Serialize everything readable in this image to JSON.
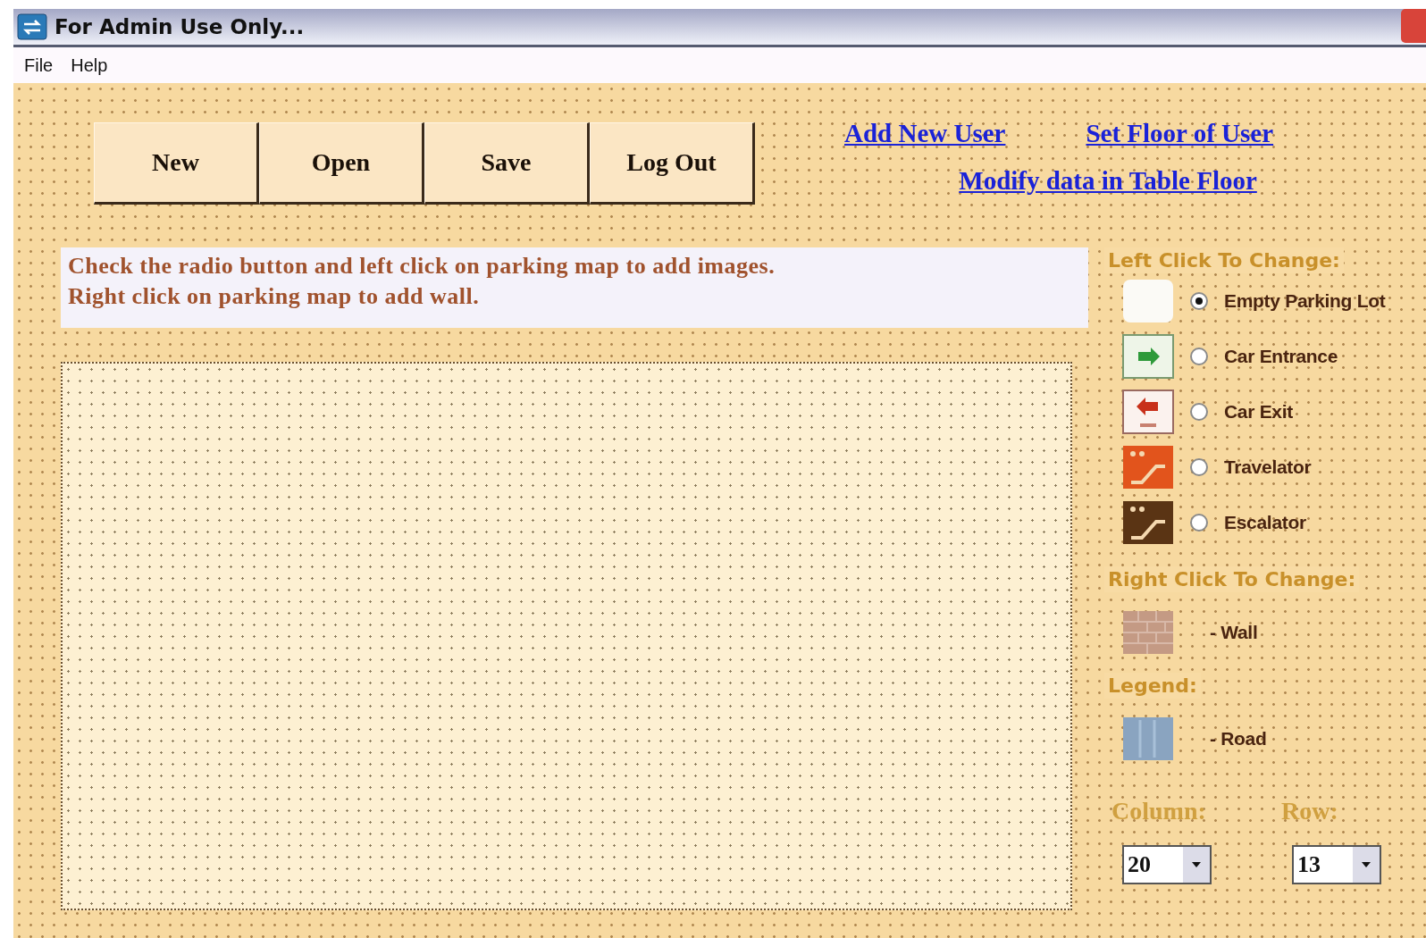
{
  "window": {
    "title": "For Admin Use Only..."
  },
  "menu": [
    "File",
    "Help"
  ],
  "toolbar_buttons": [
    "New",
    "Open",
    "Save",
    "Log Out"
  ],
  "links": [
    "Add New User",
    "Set Floor of User",
    "Modify data in Table Floor"
  ],
  "instructions": [
    "Check the radio button and left click on parking map to add images.",
    "Right click on parking map to add wall."
  ],
  "left_click_heading": "Left Click To Change:",
  "tile_options": [
    {
      "kind": "empty",
      "label": "Empty Parking Lot",
      "selected": true
    },
    {
      "kind": "entrance",
      "label": "Car Entrance",
      "selected": false
    },
    {
      "kind": "exit",
      "label": "Car Exit",
      "selected": false
    },
    {
      "kind": "travelator",
      "label": "Travelator",
      "selected": false
    },
    {
      "kind": "escalator",
      "label": "Escalator",
      "selected": false
    }
  ],
  "right_click_heading": "Right Click To Change:",
  "right_click_items": [
    {
      "kind": "wall",
      "label": "- Wall"
    }
  ],
  "legend_heading": "Legend:",
  "legend_items": [
    {
      "kind": "road",
      "label": "- Road"
    }
  ],
  "column": {
    "label": "Column:",
    "value": "20"
  },
  "row": {
    "label": "Row:",
    "value": "13"
  }
}
